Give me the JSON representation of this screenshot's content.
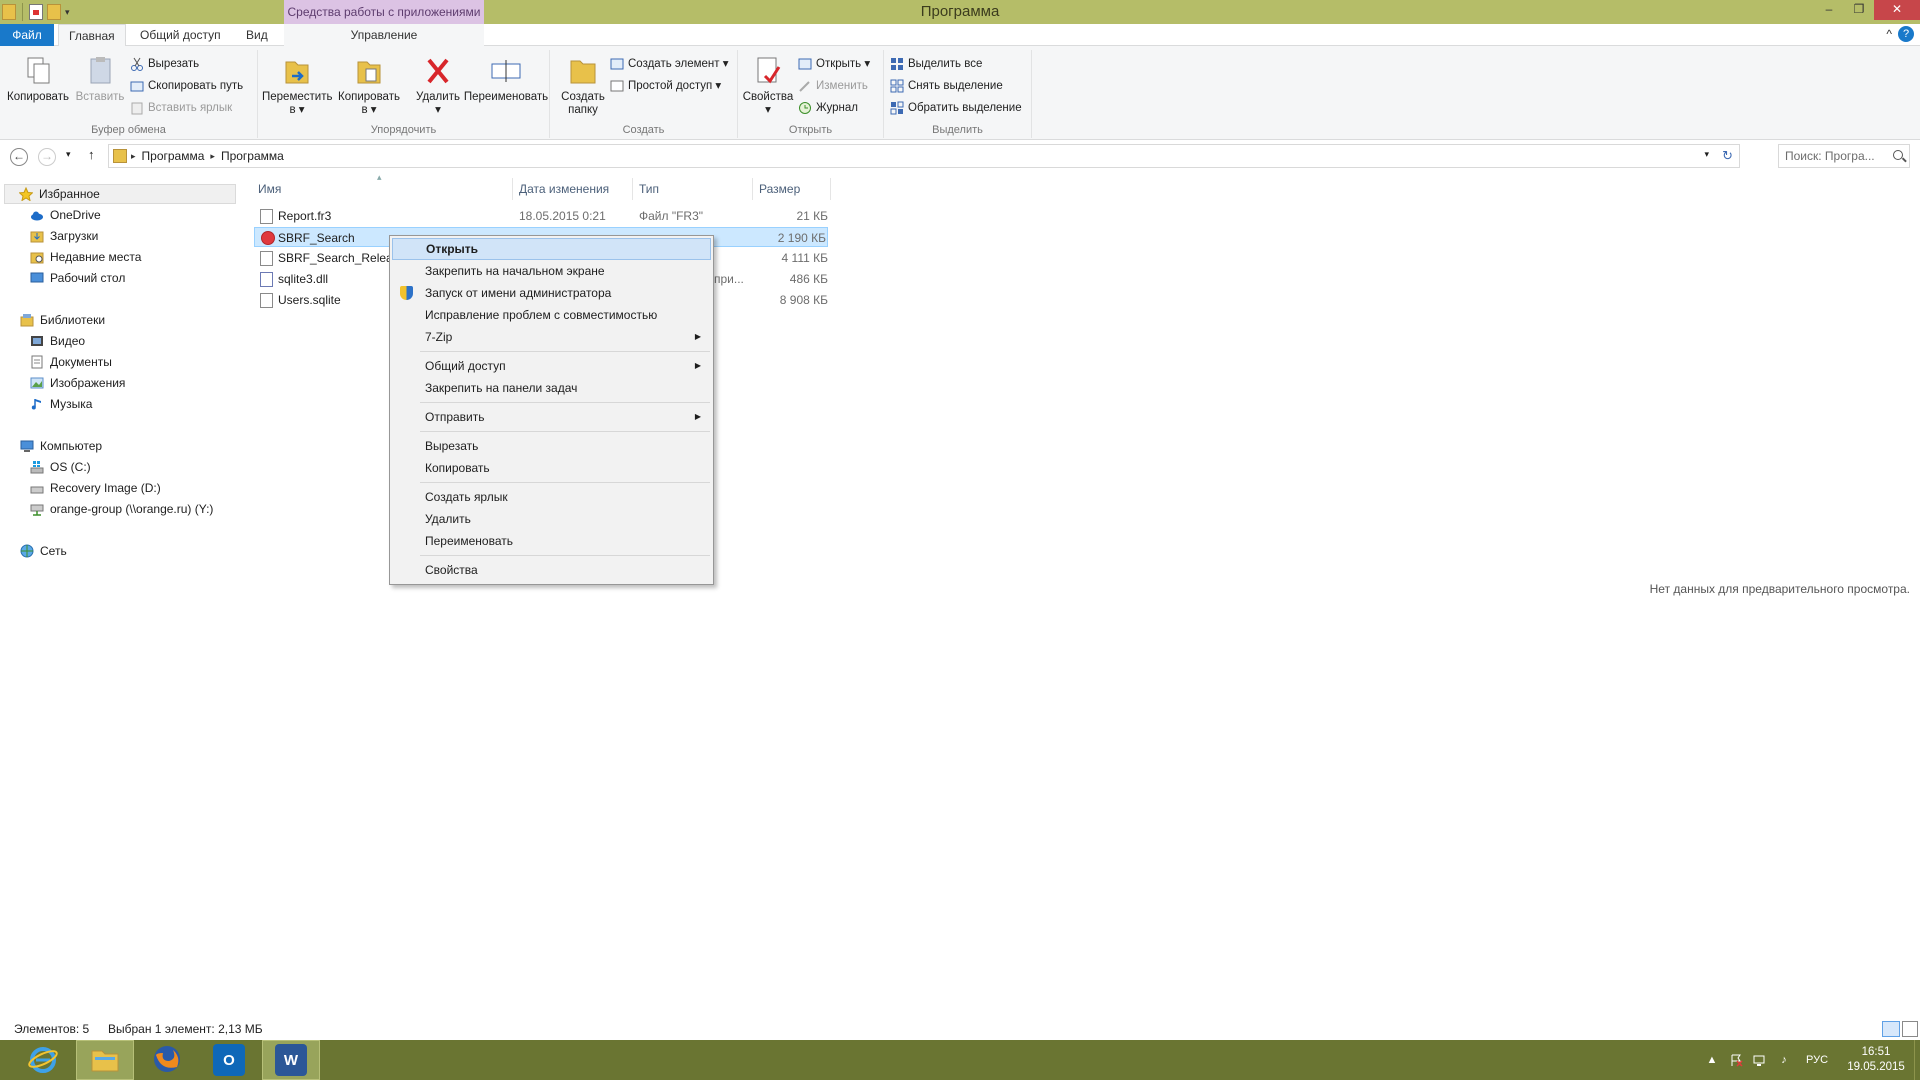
{
  "titlebar": {
    "title": "Программа",
    "context_tools": "Средства работы с приложениями",
    "controls": {
      "minimize": "–",
      "restore": "❐",
      "close": "✕"
    }
  },
  "tabs": {
    "file": "Файл",
    "home": "Главная",
    "share": "Общий доступ",
    "view": "Вид",
    "manage": "Управление"
  },
  "ribbon": {
    "clipboard": {
      "label": "Буфер обмена",
      "copy": "Копировать",
      "paste": "Вставить",
      "cut": "Вырезать",
      "copy_path": "Скопировать путь",
      "paste_shortcut": "Вставить ярлык"
    },
    "organize": {
      "label": "Упорядочить",
      "move_line1": "Переместить",
      "move_line2": "в ▾",
      "copy_line1": "Копировать",
      "copy_line2": "в ▾",
      "delete_line1": "Удалить",
      "delete_line2": "▾",
      "rename": "Переименовать"
    },
    "new": {
      "label": "Создать",
      "new_folder_line1": "Создать",
      "new_folder_line2": "папку",
      "new_item": "Создать элемент ▾",
      "easy_access": "Простой доступ ▾"
    },
    "open": {
      "label": "Открыть",
      "properties_line1": "Свойства",
      "properties_line2": "▾",
      "open": "Открыть ▾",
      "edit": "Изменить",
      "history": "Журнал"
    },
    "select": {
      "label": "Выделить",
      "select_all": "Выделить все",
      "select_none": "Снять выделение",
      "invert": "Обратить выделение"
    }
  },
  "address": {
    "crumbs": [
      "Программа",
      "Программа"
    ],
    "search_placeholder": "Поиск: Програ..."
  },
  "nav": {
    "favorites": "Избранное",
    "onedrive": "OneDrive",
    "downloads": "Загрузки",
    "recent": "Недавние места",
    "desktop": "Рабочий стол",
    "libraries": "Библиотеки",
    "video": "Видео",
    "documents": "Документы",
    "pictures": "Изображения",
    "music": "Музыка",
    "computer": "Компьютер",
    "os": "OS (C:)",
    "recovery": "Recovery Image (D:)",
    "network_drive": "orange-group (\\\\orange.ru) (Y:)",
    "network": "Сеть"
  },
  "columns": {
    "name": "Имя",
    "date": "Дата изменения",
    "type": "Тип",
    "size": "Размер"
  },
  "files": [
    {
      "name": "Report.fr3",
      "date": "18.05.2015 0:21",
      "type": "Файл \"FR3\"",
      "size": "21 КБ"
    },
    {
      "name": "SBRF_Search",
      "date": "",
      "type": "",
      "size": "2 190 КБ"
    },
    {
      "name": "SBRF_Search_Release",
      "date": "",
      "type": "",
      "size": "4 111 КБ"
    },
    {
      "name": "sqlite3.dll",
      "date": "",
      "type": "при...",
      "size": "486 КБ"
    },
    {
      "name": "Users.sqlite",
      "date": "",
      "type": "",
      "size": "8 908 КБ"
    }
  ],
  "context_menu": {
    "open": "Открыть",
    "pin_start": "Закрепить на начальном экране",
    "run_as_admin": "Запуск от имени администратора",
    "troubleshoot": "Исправление проблем с совместимостью",
    "sevenzip": "7-Zip",
    "share": "Общий доступ",
    "pin_taskbar": "Закрепить на панели задач",
    "send_to": "Отправить",
    "cut": "Вырезать",
    "copy": "Копировать",
    "create_shortcut": "Создать ярлык",
    "delete": "Удалить",
    "rename": "Переименовать",
    "properties": "Свойства"
  },
  "preview": "Нет данных для предварительного просмотра.",
  "status": {
    "items": "Элементов: 5",
    "selected": "Выбран 1 элемент: 2,13 МБ"
  },
  "taskbar": {
    "language": "РУС",
    "time": "16:51",
    "date": "19.05.2015",
    "outlook_letter": "O",
    "word_letter": "W",
    "tray_arrow": "▲",
    "volume_glyph": "♪"
  },
  "icons": {
    "back": "←",
    "forward": "→",
    "recent_dropdown": "▾",
    "up": "↑",
    "breadcrumb_separator": "▸",
    "refresh": "↻",
    "sort_up": "▴",
    "collapse_ribbon": "^",
    "help": "?",
    "submenu_arrow": "▶"
  },
  "colors": {
    "titlebar": "#b5bd68",
    "taskbar": "#6a7532",
    "accent": "#1979ca",
    "selection": "#cce8ff",
    "context_tools": "#dcc3e4"
  }
}
